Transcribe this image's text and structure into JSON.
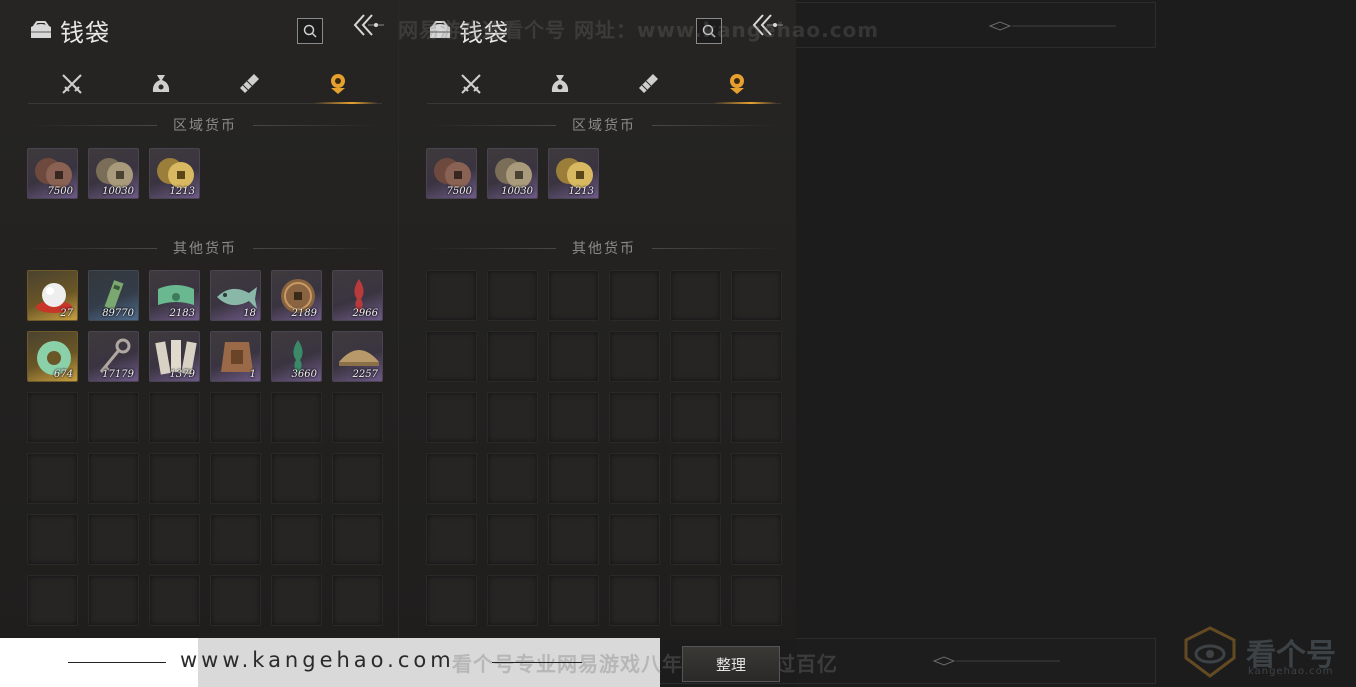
{
  "panels": [
    {
      "title": "钱袋",
      "tabs": [
        "weapons-icon",
        "pouch-icon",
        "scroll-icon",
        "coin-tab-icon"
      ],
      "active_tab": 3,
      "regional_title": "区域货币",
      "regional_items": [
        {
          "icon": "copper-coins-icon",
          "qty": "7500",
          "rarity": "purple"
        },
        {
          "icon": "silver-coins-icon",
          "qty": "10030",
          "rarity": "purple"
        },
        {
          "icon": "gold-coins-icon",
          "qty": "1213",
          "rarity": "purple"
        }
      ],
      "other_title": "其他货币",
      "other_items": [
        {
          "icon": "pearl-icon",
          "qty": "27",
          "rarity": "gold"
        },
        {
          "icon": "jade-token-icon",
          "qty": "89770",
          "rarity": "blue"
        },
        {
          "icon": "green-banknote-icon",
          "qty": "2183",
          "rarity": "purple"
        },
        {
          "icon": "jade-fish-icon",
          "qty": "18",
          "rarity": "purple"
        },
        {
          "icon": "bronze-coin-icon",
          "qty": "2189",
          "rarity": "purple"
        },
        {
          "icon": "red-flame-icon",
          "qty": "2966",
          "rarity": "purple"
        },
        {
          "icon": "jade-ring-icon",
          "qty": "674",
          "rarity": "gold"
        },
        {
          "icon": "key-sword-icon",
          "qty": "17179",
          "rarity": "purple"
        },
        {
          "icon": "paper-slips-icon",
          "qty": "1379",
          "rarity": "purple"
        },
        {
          "icon": "wooden-plaque-icon",
          "qty": "1",
          "rarity": "purple"
        },
        {
          "icon": "green-flame-icon",
          "qty": "3660",
          "rarity": "purple"
        },
        {
          "icon": "bronze-bowl-icon",
          "qty": "2257",
          "rarity": "purple"
        }
      ]
    },
    {
      "title": "钱袋",
      "tabs": [
        "weapons-icon",
        "pouch-icon",
        "scroll-icon",
        "coin-tab-icon"
      ],
      "active_tab": 3,
      "regional_title": "区域货币",
      "regional_items": [
        {
          "icon": "copper-coins-icon",
          "qty": "7500",
          "rarity": "purple"
        },
        {
          "icon": "silver-coins-icon",
          "qty": "10030",
          "rarity": "purple"
        },
        {
          "icon": "gold-coins-icon",
          "qty": "1213",
          "rarity": "purple"
        }
      ],
      "other_title": "其他货币",
      "other_items": []
    }
  ],
  "sort_button": "整理",
  "watermark_top": "网易游戏选看个号 网址：www.kangehao.com",
  "watermark_bottom": "看个号专业网易游戏八年 年交易额过百亿",
  "url_text": "www.kangehao.com",
  "logo": {
    "name": "看个号",
    "domain": "kangehao.com"
  },
  "colors": {
    "accent": "#e6a030",
    "purple_rarity": "#6e5a88",
    "gold_rarity": "#c8a040",
    "blue_rarity": "#4f6a8c"
  }
}
